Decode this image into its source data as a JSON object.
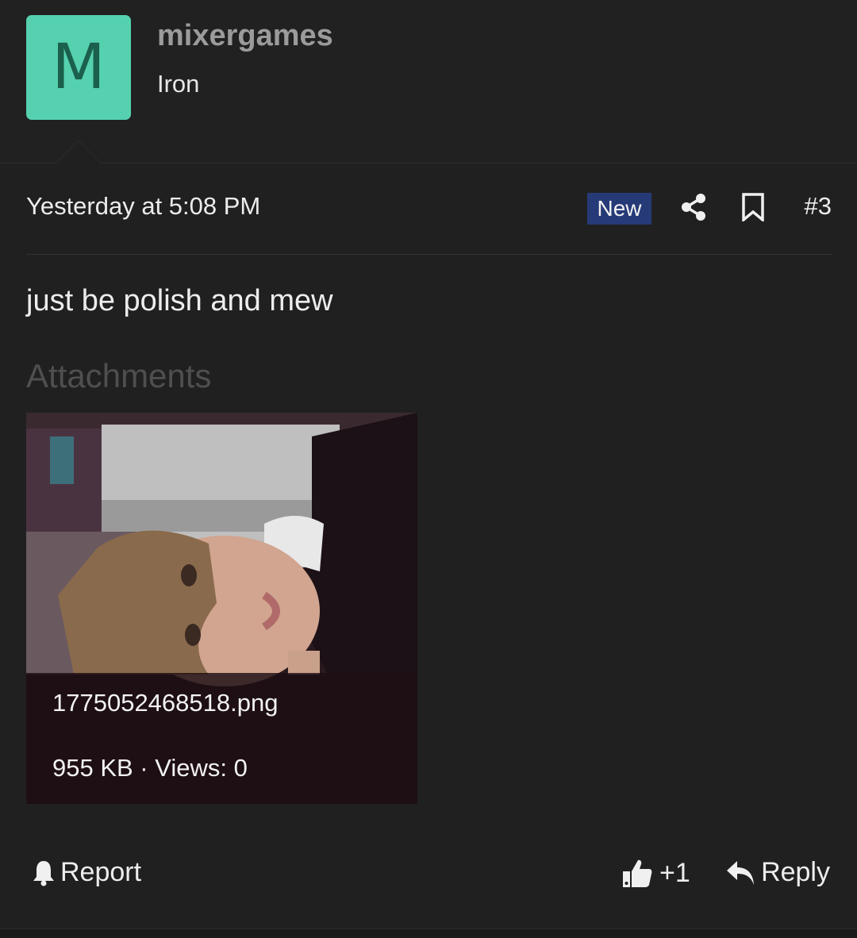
{
  "user": {
    "avatar_letter": "M",
    "username": "mixergames",
    "title": "Iron"
  },
  "meta": {
    "timestamp": "Yesterday at 5:08 PM",
    "badge": "New",
    "post_number": "#3",
    "share_icon": "share-icon",
    "bookmark_icon": "bookmark-icon"
  },
  "message": "just be polish and mew",
  "attachments": {
    "heading": "Attachments",
    "items": [
      {
        "filename": "1775052468518.png",
        "meta": "955 KB · Views: 0"
      }
    ]
  },
  "actions": {
    "report": "Report",
    "like_count": "+1",
    "reply": "Reply"
  },
  "colors": {
    "background": "#202020",
    "avatar": "#55d1af",
    "avatar_letter": "#1b5f4d",
    "badge": "#263a78",
    "username": "#9b9b9b"
  }
}
